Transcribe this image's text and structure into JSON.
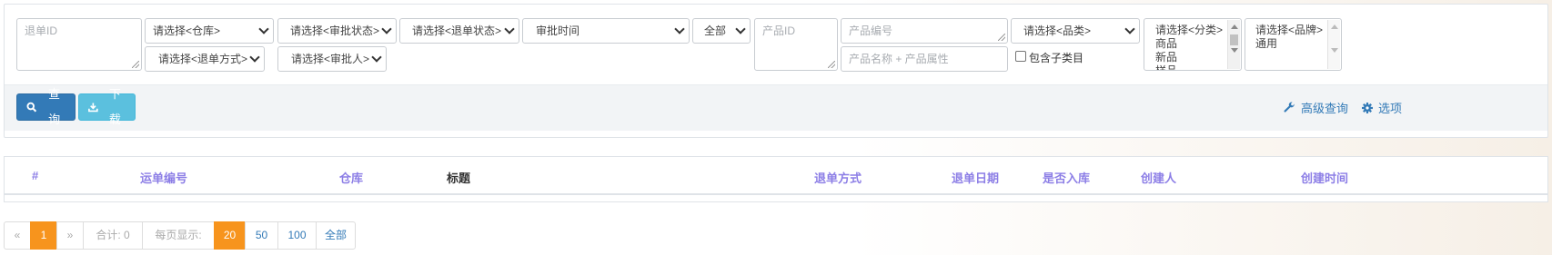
{
  "filters": {
    "return_id_placeholder": "退单ID",
    "warehouse_select": "请选择<仓库>",
    "approval_status_select": "请选择<审批状态>",
    "return_status_select": "请选择<退单状态>",
    "approval_time_select": "审批时间",
    "all_select": "全部",
    "product_id_placeholder": "产品ID",
    "product_code_placeholder": "产品编号",
    "category_select": "请选择<品类>",
    "classification_list": [
      "请选择<分类>",
      "商品",
      "新品",
      "样品"
    ],
    "brand_list": [
      "请选择<品牌>",
      "通用"
    ],
    "return_method_select": "请选择<退单方式>",
    "approver_select": "请选择<审批人>",
    "product_name_placeholder": "产品名称 + 产品属性",
    "include_subcategory_label": "包含子类目"
  },
  "toolbar": {
    "query_label": "查询",
    "download_label": "下载",
    "advanced_query_label": "高级查询",
    "options_label": "选项"
  },
  "table": {
    "columns": [
      "#",
      "运单编号",
      "仓库",
      "标题",
      "退单方式",
      "退单日期",
      "是否入库",
      "创建人",
      "创建时间"
    ],
    "rows": []
  },
  "pagination": {
    "prev_label": "«",
    "current_page": "1",
    "next_label": "»",
    "total_label": "合计: 0",
    "per_page_label": "每页显示:",
    "page_sizes": [
      "20",
      "50",
      "100",
      "全部"
    ],
    "selected_page_size": "20"
  },
  "colors": {
    "primary": "#337ab7",
    "info": "#5bc0de",
    "active_orange": "#f7941d",
    "header_purple": "#8c7ee6"
  }
}
